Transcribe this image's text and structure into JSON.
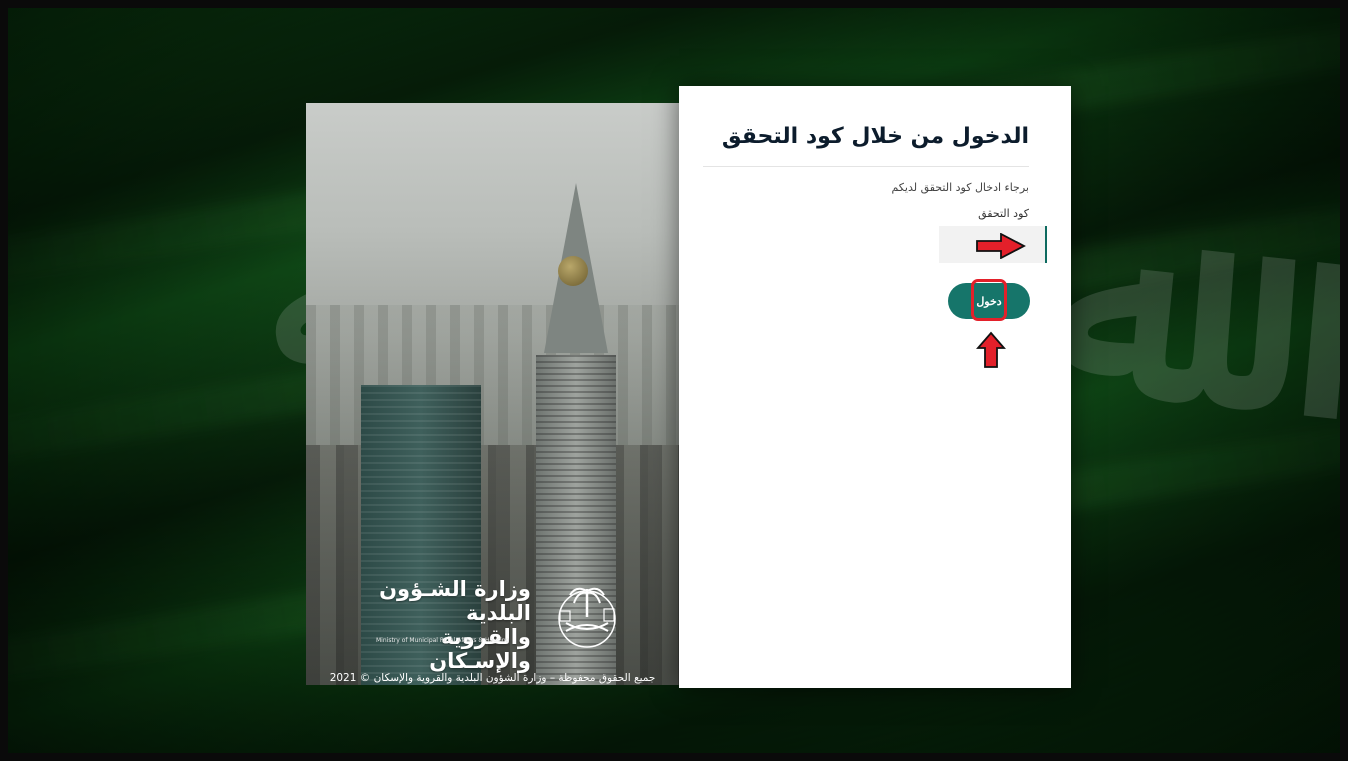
{
  "login": {
    "title": "الدخول من خلال كود التحقق",
    "instruction": "برجاء ادخال كود التحقق لديكم",
    "code_label": "كود التحقق",
    "code_value": "",
    "submit_label": "دخول"
  },
  "branding": {
    "ministry_name_line1": "وزارة الشـؤون البلدية",
    "ministry_name_line2": "والقروية والإسـكان",
    "ministry_name_en": "Ministry of Municipal Rural Affairs & Housing",
    "copyright": "جميع الحقوق محفوظة – وزارة الشؤون البلدية والقروية والإسكان © 2021"
  },
  "annotations": {
    "arrow_color": "#e3202a"
  },
  "colors": {
    "primary": "#16756a",
    "title": "#0c1c2c",
    "background": "#0f4716"
  }
}
